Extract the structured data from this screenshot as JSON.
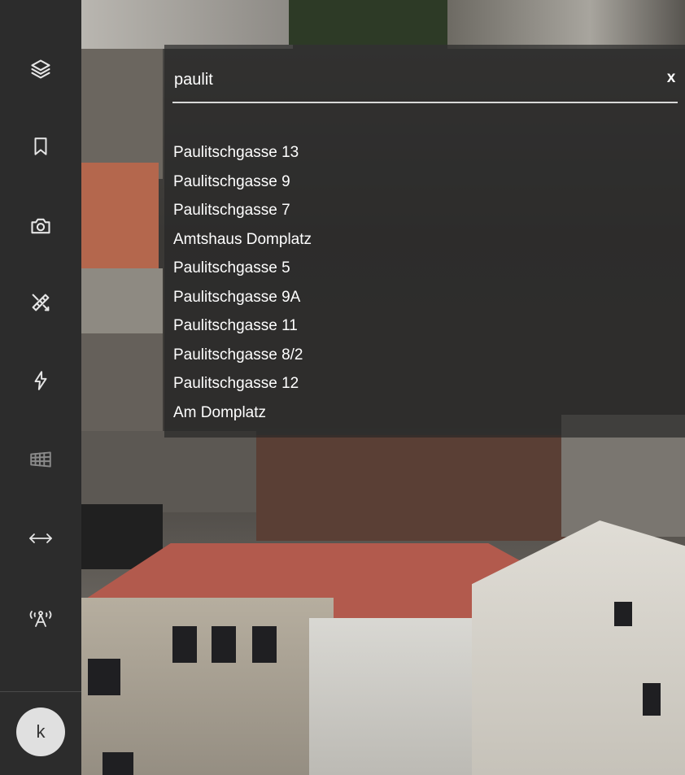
{
  "search": {
    "value": "paulit",
    "close_label": "x"
  },
  "results": [
    "Paulitschgasse 13",
    "Paulitschgasse 9",
    "Paulitschgasse 7",
    "Amtshaus Domplatz",
    "Paulitschgasse 5",
    "Paulitschgasse 9A",
    "Paulitschgasse 11",
    "Paulitschgasse 8/2",
    "Paulitschgasse 12",
    "Am Domplatz"
  ],
  "sidebar": {
    "tools": [
      {
        "icon": "layers-icon"
      },
      {
        "icon": "bookmark-icon"
      },
      {
        "icon": "camera-icon"
      },
      {
        "icon": "measure-tools-icon"
      },
      {
        "icon": "lightning-icon"
      },
      {
        "icon": "grid-wall-icon"
      },
      {
        "icon": "horizontal-arrows-icon"
      },
      {
        "icon": "antenna-icon"
      }
    ],
    "avatar_initial": "k"
  },
  "colors": {
    "sidebar_bg": "#2c2c2c",
    "panel_bg": "rgba(40,40,40,0.70)",
    "text": "#ffffff"
  }
}
